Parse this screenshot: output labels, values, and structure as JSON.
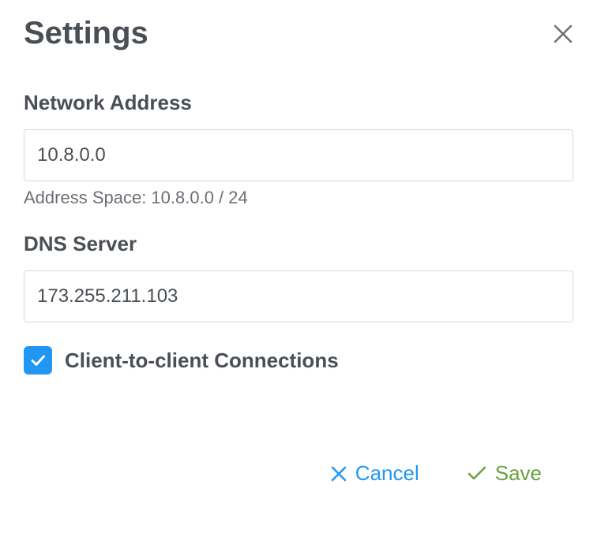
{
  "dialog": {
    "title": "Settings"
  },
  "network_address": {
    "label": "Network Address",
    "value": "10.8.0.0",
    "help_text": "Address Space: 10.8.0.0 / 24"
  },
  "dns_server": {
    "label": "DNS Server",
    "value": "173.255.211.103"
  },
  "c2c": {
    "label": "Client-to-client Connections",
    "checked": true
  },
  "actions": {
    "cancel": "Cancel",
    "save": "Save"
  }
}
